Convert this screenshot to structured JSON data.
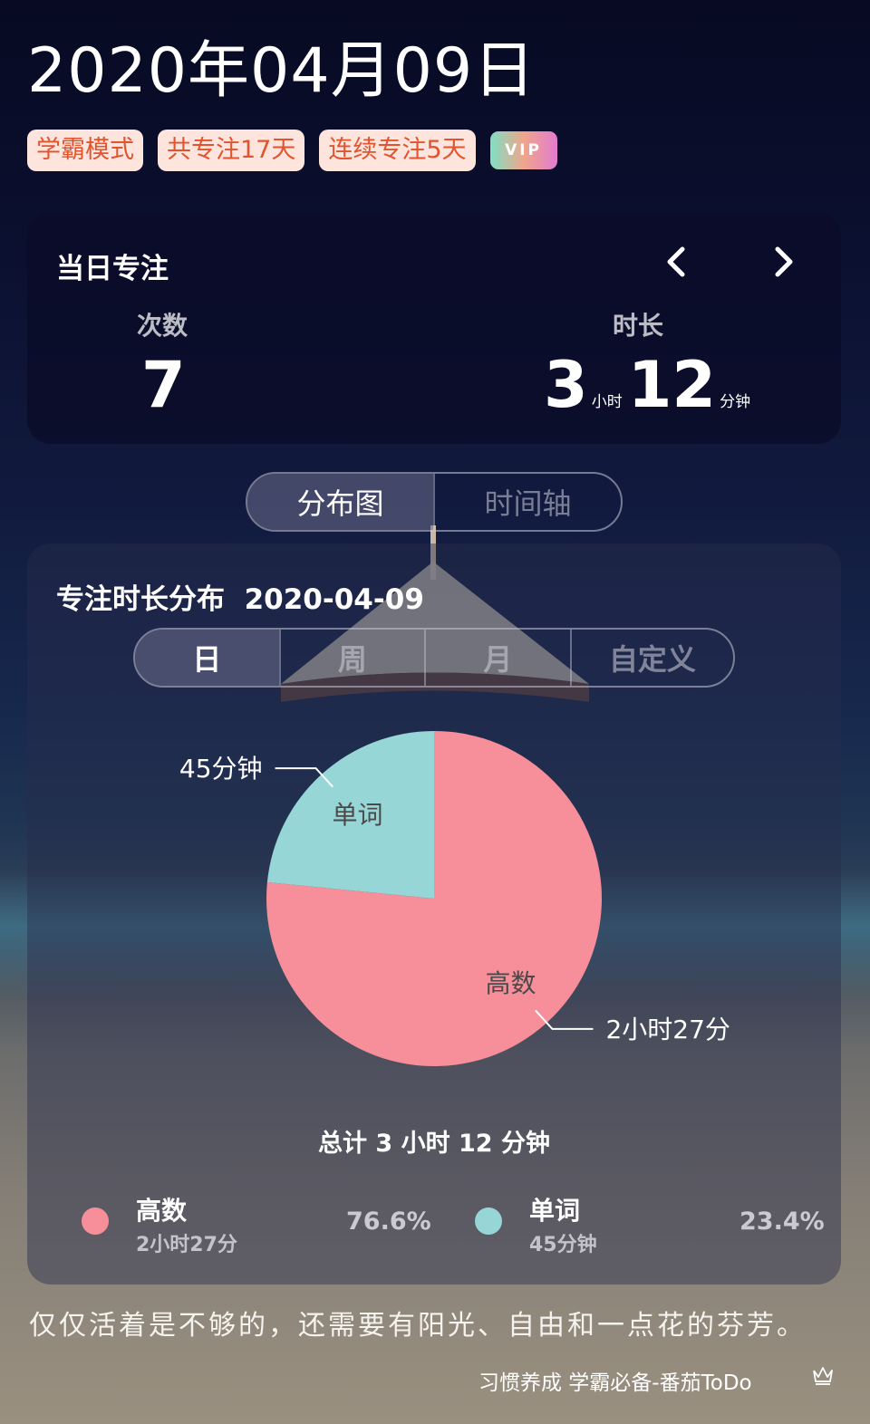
{
  "header": {
    "date": "2020年04月09日",
    "tags": [
      "学霸模式",
      "共专注17天",
      "连续专注5天"
    ],
    "vip": "VIP"
  },
  "daily_focus": {
    "title": "当日专注",
    "count_label": "次数",
    "count_value": "7",
    "duration_label": "时长",
    "hours": "3",
    "hours_unit": "小时",
    "minutes": "12",
    "minutes_unit": "分钟"
  },
  "view_tabs": [
    "分布图",
    "时间轴"
  ],
  "distribution": {
    "title": "专注时长分布",
    "date": "2020-04-09",
    "period_tabs": [
      "日",
      "周",
      "月",
      "自定义"
    ],
    "total": "总计 3 小时 12 分钟"
  },
  "chart_data": {
    "type": "pie",
    "slices": [
      {
        "name": "高数",
        "duration_label": "2小时27分",
        "legend_duration": "2小时27分",
        "minutes": 147,
        "percent": "76.6%",
        "color": "#f68f9a"
      },
      {
        "name": "单词",
        "duration_label": "45分钟",
        "legend_duration": "45分钟",
        "minutes": 45,
        "percent": "23.4%",
        "color": "#97d6d6"
      }
    ]
  },
  "footer": {
    "quote": "仅仅活着是不够的，还需要有阳光、自由和一点花的芬芳。",
    "brand": "习惯养成 学霸必备-番茄ToDo"
  },
  "colors": {
    "tag_bg": "#fde4dc",
    "tag_text": "#e2542e"
  }
}
